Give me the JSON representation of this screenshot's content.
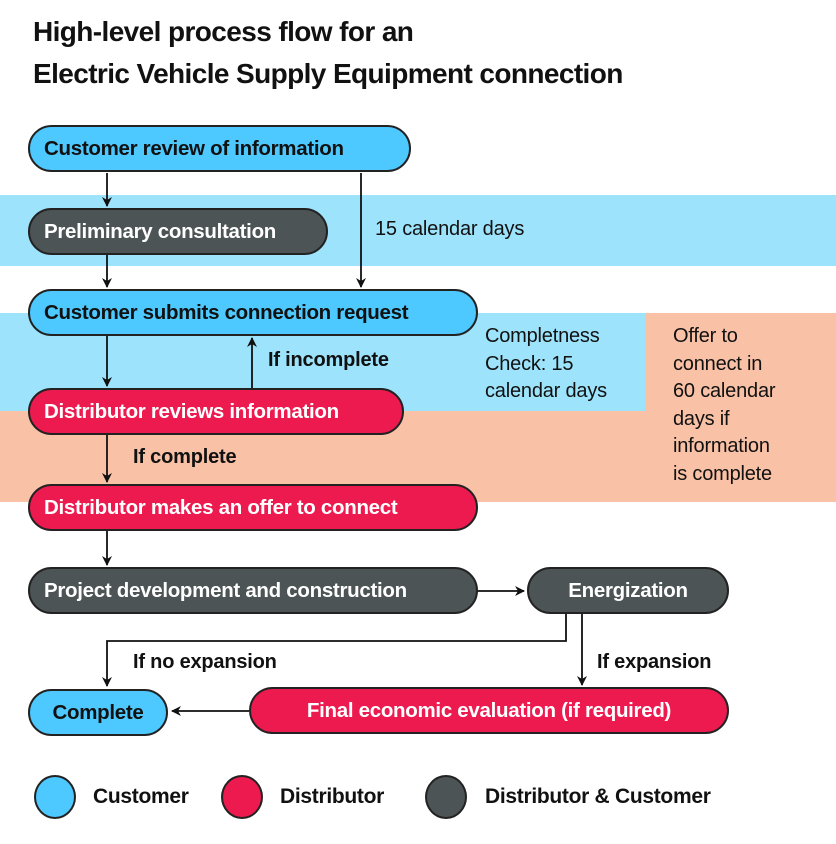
{
  "title": {
    "line1": "High-level process flow for an",
    "line2": "Electric Vehicle Supply Equipment connection"
  },
  "colors": {
    "customer": "#4DC9FF",
    "distributor": "#EC1A4F",
    "shared": "#4D5456",
    "band_blue": "#9DE3FB",
    "band_salmon": "#F9C1A6"
  },
  "nodes": {
    "customer_review": {
      "label": "Customer review of information",
      "role": "customer"
    },
    "preliminary_consultation": {
      "label": "Preliminary consultation",
      "role": "shared"
    },
    "submit_request": {
      "label": "Customer submits connection request",
      "role": "customer"
    },
    "distributor_reviews": {
      "label": "Distributor reviews information",
      "role": "distributor"
    },
    "offer_to_connect": {
      "label": "Distributor makes an offer to connect",
      "role": "distributor"
    },
    "project_development": {
      "label": "Project development and construction",
      "role": "shared"
    },
    "energization": {
      "label": "Energization",
      "role": "shared"
    },
    "final_evaluation": {
      "label": "Final economic evaluation (if required)",
      "role": "distributor"
    },
    "complete": {
      "label": "Complete",
      "role": "customer"
    }
  },
  "edge_labels": {
    "if_incomplete": "If incomplete",
    "if_complete": "If complete",
    "if_no_expansion": "If no expansion",
    "if_expansion": "If expansion"
  },
  "timeline_notes": {
    "consultation_period": "15 calendar days",
    "completeness_check": [
      "Completness",
      "Check: 15",
      "calendar days"
    ],
    "offer_period": [
      "Offer to",
      "connect in",
      "60 calendar",
      "days if",
      "information",
      "is complete"
    ]
  },
  "legend": [
    {
      "label": "Customer",
      "role": "customer"
    },
    {
      "label": "Distributor",
      "role": "distributor"
    },
    {
      "label": "Distributor & Customer",
      "role": "shared"
    }
  ]
}
